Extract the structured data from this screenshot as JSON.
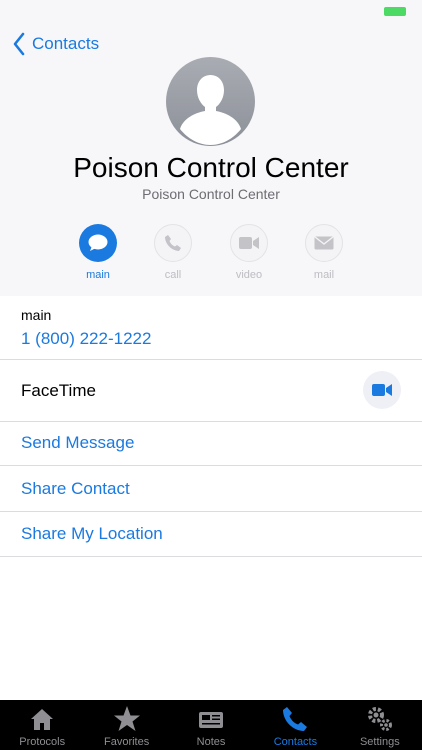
{
  "colors": {
    "accent": "#1a7ae0",
    "header_bg": "#f7f7f9",
    "tabbar_bg": "#000000",
    "inactive_gray": "#8e8e93"
  },
  "nav": {
    "back_label": "Contacts"
  },
  "contact": {
    "name": "Poison Control Center",
    "subtitle": "Poison Control Center"
  },
  "actions": [
    {
      "label": "main",
      "icon": "message-bubble-icon",
      "active": true
    },
    {
      "label": "call",
      "icon": "phone-icon",
      "active": false
    },
    {
      "label": "video",
      "icon": "video-camera-icon",
      "active": false
    },
    {
      "label": "mail",
      "icon": "envelope-icon",
      "active": false
    }
  ],
  "phone": {
    "label": "main",
    "value": "1 (800) 222-1222"
  },
  "facetime": {
    "label": "FaceTime",
    "icon": "video-camera-icon"
  },
  "links": [
    "Send Message",
    "Share Contact",
    "Share My Location"
  ],
  "tabbar": [
    {
      "label": "Protocols",
      "icon": "house-icon",
      "active": false
    },
    {
      "label": "Favorites",
      "icon": "star-icon",
      "active": false
    },
    {
      "label": "Notes",
      "icon": "newspaper-icon",
      "active": false
    },
    {
      "label": "Contacts",
      "icon": "phone-icon",
      "active": true
    },
    {
      "label": "Settings",
      "icon": "gears-icon",
      "active": false
    }
  ]
}
